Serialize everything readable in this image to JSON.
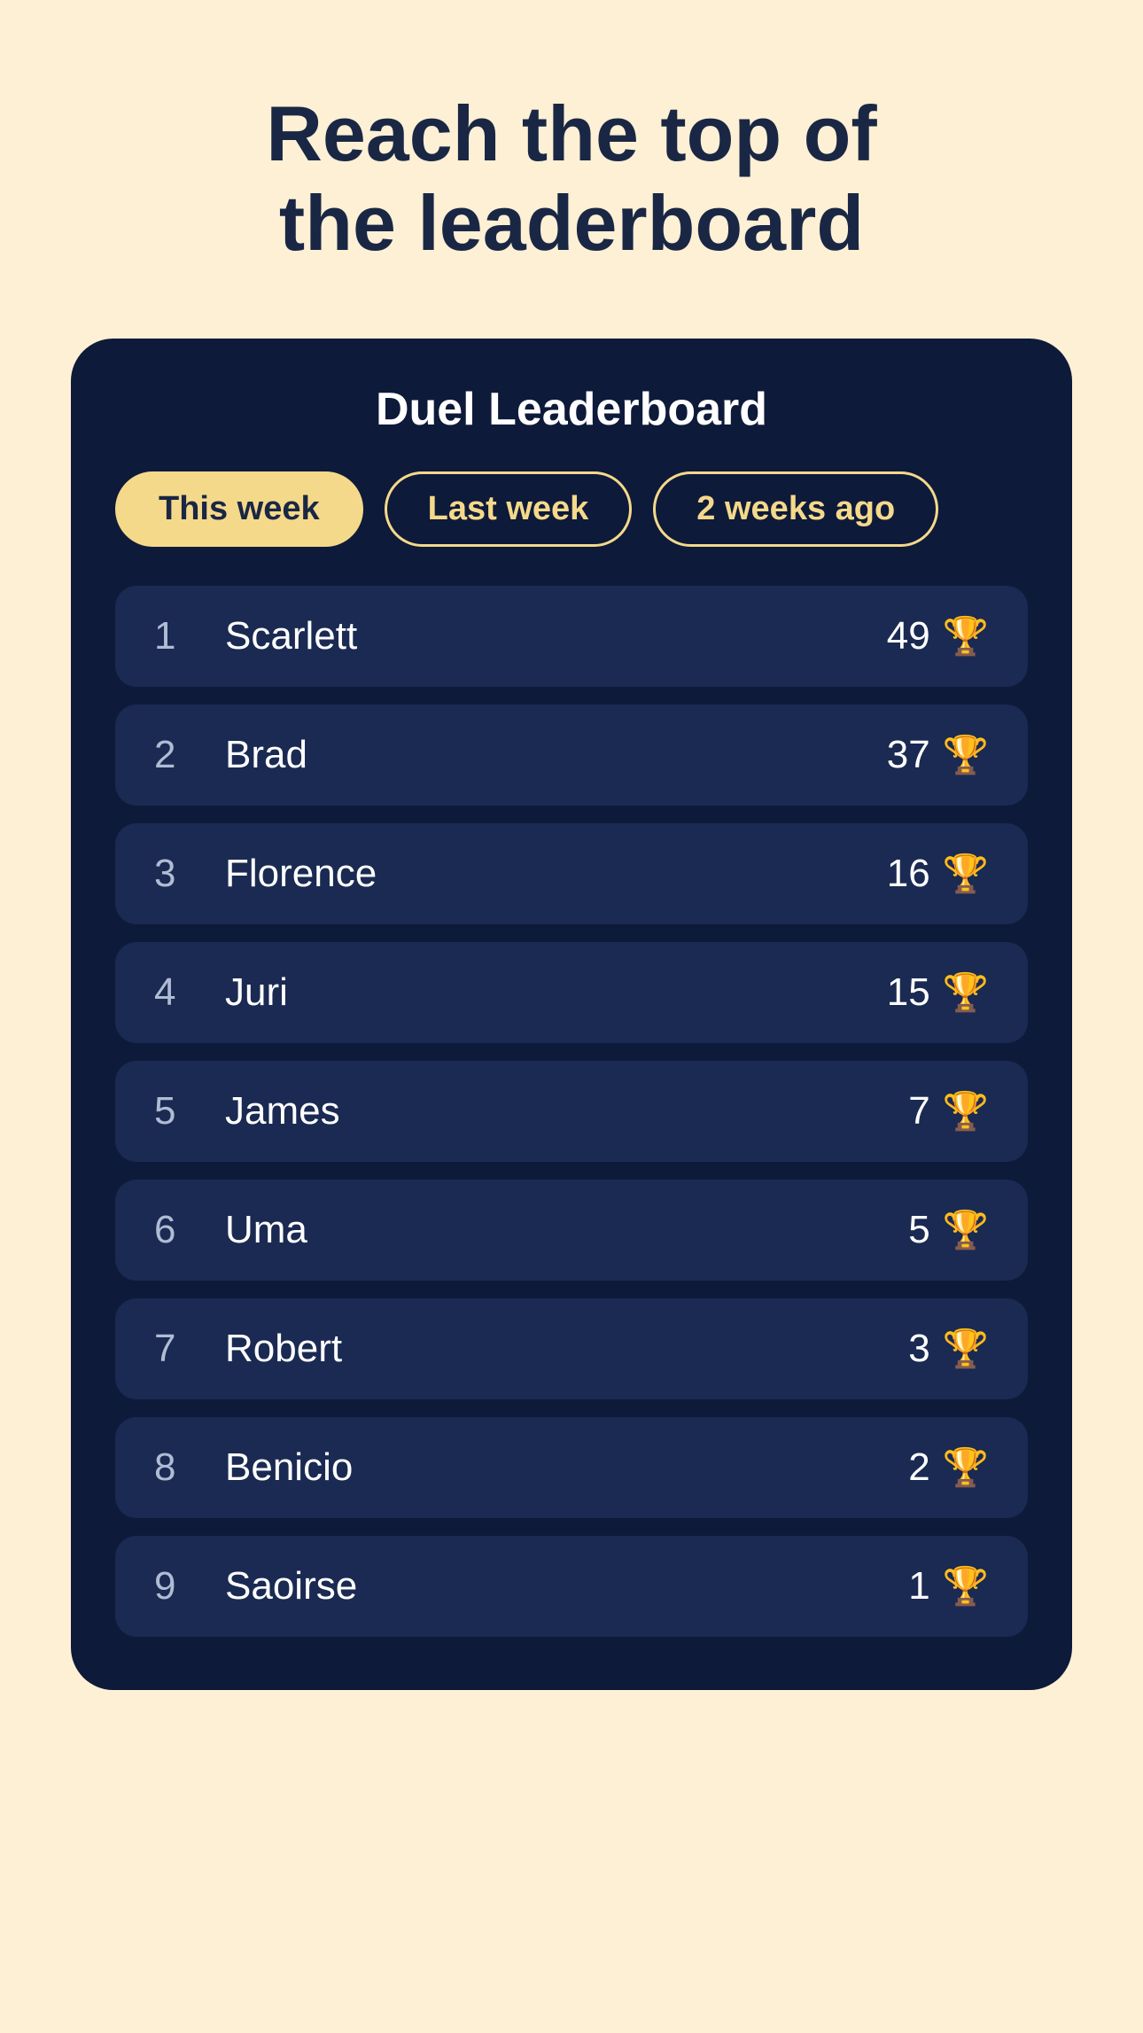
{
  "page": {
    "background_color": "#fdf0d5",
    "title": "Reach the top of the leaderboard"
  },
  "card": {
    "title": "Duel Leaderboard"
  },
  "tabs": [
    {
      "label": "This week",
      "active": true
    },
    {
      "label": "Last week",
      "active": false
    },
    {
      "label": "2 weeks ago",
      "active": false
    }
  ],
  "leaderboard": [
    {
      "rank": "1",
      "name": "Scarlett",
      "score": "49"
    },
    {
      "rank": "2",
      "name": "Brad",
      "score": "37"
    },
    {
      "rank": "3",
      "name": "Florence",
      "score": "16"
    },
    {
      "rank": "4",
      "name": "Juri",
      "score": "15"
    },
    {
      "rank": "5",
      "name": "James",
      "score": "7"
    },
    {
      "rank": "6",
      "name": "Uma",
      "score": "5"
    },
    {
      "rank": "7",
      "name": "Robert",
      "score": "3"
    },
    {
      "rank": "8",
      "name": "Benicio",
      "score": "2"
    },
    {
      "rank": "9",
      "name": "Saoirse",
      "score": "1"
    }
  ],
  "icons": {
    "trophy": "🏆"
  }
}
